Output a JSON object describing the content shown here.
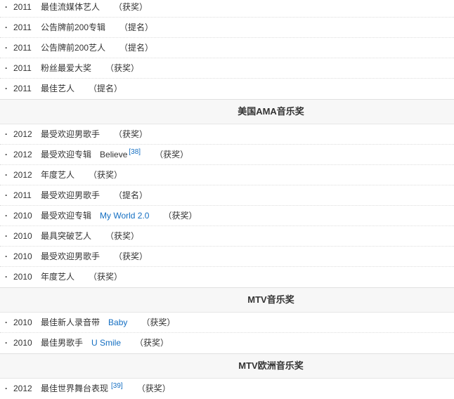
{
  "groups": [
    {
      "title": null,
      "items": [
        {
          "year": "2011",
          "award": "最佳流媒体艺人",
          "work": "",
          "ref": "",
          "status": "（获奖）"
        },
        {
          "year": "2011",
          "award": "公告牌前200专辑",
          "work": "",
          "ref": "",
          "status": "（提名）"
        },
        {
          "year": "2011",
          "award": "公告牌前200艺人",
          "work": "",
          "ref": "",
          "status": "（提名）"
        },
        {
          "year": "2011",
          "award": "粉丝最爱大奖",
          "work": "",
          "ref": "",
          "status": "（获奖）"
        },
        {
          "year": "2011",
          "award": "最佳艺人",
          "work": "",
          "ref": "",
          "status": "（提名）"
        }
      ]
    },
    {
      "title": "美国AMA音乐奖",
      "items": [
        {
          "year": "2012",
          "award": "最受欢迎男歌手",
          "work": "",
          "ref": "",
          "status": "（获奖）"
        },
        {
          "year": "2012",
          "award": "最受欢迎专辑",
          "work": "Believe",
          "work_link": false,
          "ref": "[38]",
          "status": "（获奖）"
        },
        {
          "year": "2012",
          "award": "年度艺人",
          "work": "",
          "ref": "",
          "status": "（获奖）"
        },
        {
          "year": "2011",
          "award": "最受欢迎男歌手",
          "work": "",
          "ref": "",
          "status": "（提名）"
        },
        {
          "year": "2010",
          "award": "最受欢迎专辑",
          "work": "My World 2.0",
          "work_link": true,
          "ref": "",
          "status": "（获奖）"
        },
        {
          "year": "2010",
          "award": "最具突破艺人",
          "work": "",
          "ref": "",
          "status": "（获奖）"
        },
        {
          "year": "2010",
          "award": "最受欢迎男歌手",
          "work": "",
          "ref": "",
          "status": "（获奖）"
        },
        {
          "year": "2010",
          "award": "年度艺人",
          "work": "",
          "ref": "",
          "status": "（获奖）"
        }
      ]
    },
    {
      "title": "MTV音乐奖",
      "items": [
        {
          "year": "2010",
          "award": "最佳新人录音带",
          "work": "Baby",
          "work_link": true,
          "ref": "",
          "status": "（获奖）"
        },
        {
          "year": "2010",
          "award": "最佳男歌手",
          "work": "U Smile",
          "work_link": true,
          "ref": "",
          "status": "（获奖）"
        }
      ]
    },
    {
      "title": "MTV欧洲音乐奖",
      "items": [
        {
          "year": "2012",
          "award": "最佳世界舞台表现",
          "work": "",
          "ref": "[39]",
          "status": "（获奖）"
        }
      ]
    }
  ],
  "bullet": "·",
  "colors": {
    "link": "#136ec2",
    "text": "#333333",
    "header_bg": "#f7f7f7"
  }
}
